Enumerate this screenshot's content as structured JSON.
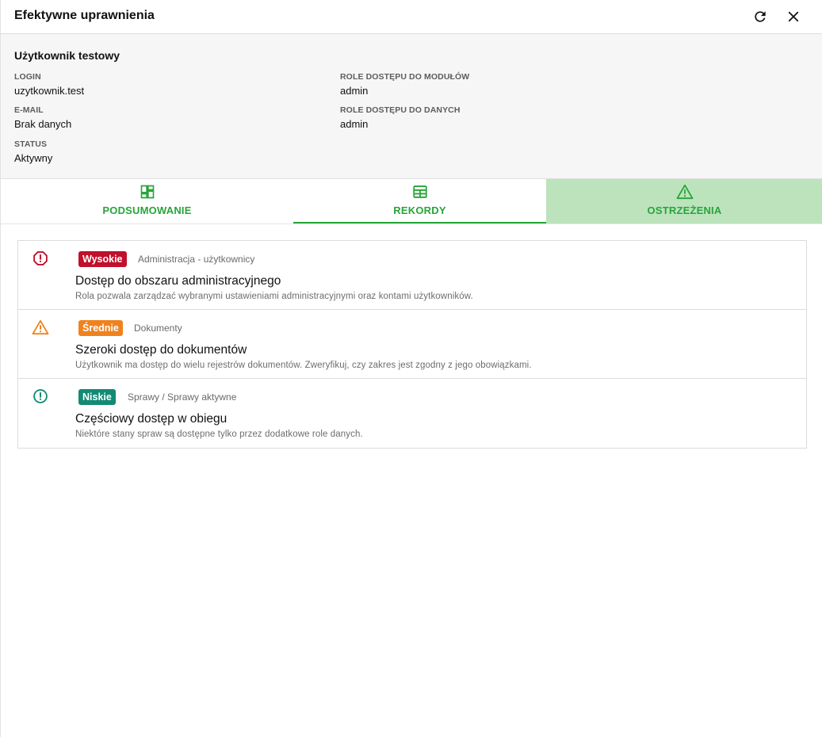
{
  "dialog": {
    "title": "Efektywne uprawnienia",
    "refresh_icon": "refresh-icon",
    "close_icon": "close-icon"
  },
  "user": {
    "name": "Użytkownik testowy",
    "fields": {
      "login_label": "LOGIN",
      "login_value": "uzytkownik.test",
      "email_label": "E-MAIL",
      "email_value": "Brak danych",
      "status_label": "STATUS",
      "status_value": "Aktywny",
      "module_roles_label": "ROLE DOSTĘPU DO MODUŁÓW",
      "module_roles_value": "admin",
      "data_roles_label": "ROLE DOSTĘPU DO DANYCH",
      "data_roles_value": "admin"
    }
  },
  "tabs": [
    {
      "label": "PODSUMOWANIE",
      "icon": "dashboard-icon",
      "state": "normal"
    },
    {
      "label": "REKORDY",
      "icon": "table-icon",
      "state": "underlined"
    },
    {
      "label": "OSTRZEŻENIA",
      "icon": "warning-triangle-icon",
      "state": "selected"
    }
  ],
  "colors": {
    "accent": "#27a53a",
    "selected_tab_bg": "#bde3bd",
    "severity_high": "#c0102b",
    "severity_medium": "#f0821e",
    "severity_low": "#128a74"
  },
  "warnings": [
    {
      "severity": "Wysokie",
      "icon": "error-octagon-icon",
      "category": "Administracja - użytkownicy",
      "title": "Dostęp do obszaru administracyjnego",
      "description": "Rola pozwala zarządzać wybranymi ustawieniami administracyjnymi oraz kontami użytkowników."
    },
    {
      "severity": "Średnie",
      "icon": "warning-triangle-icon",
      "category": "Dokumenty",
      "title": "Szeroki dostęp do dokumentów",
      "description": "Użytkownik ma dostęp do wielu rejestrów dokumentów. Zweryfikuj, czy zakres jest zgodny z jego obowiązkami."
    },
    {
      "severity": "Niskie",
      "icon": "info-circle-icon",
      "category": "Sprawy / Sprawy aktywne",
      "title": "Częściowy dostęp w obiegu",
      "description": "Niektóre stany spraw są dostępne tylko przez dodatkowe role danych."
    }
  ]
}
